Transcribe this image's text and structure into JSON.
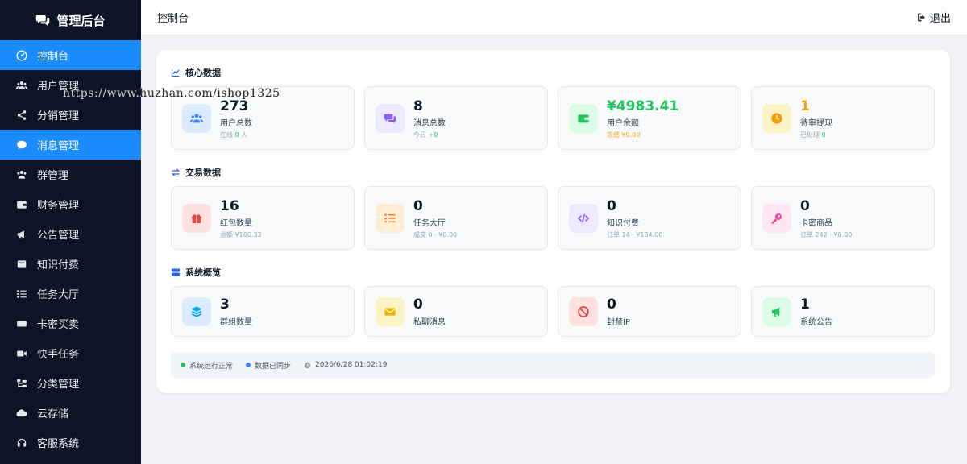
{
  "sidebar": {
    "brand": "管理后台",
    "items": [
      {
        "label": "控制台",
        "icon": "dashboard-icon",
        "active": true
      },
      {
        "label": "用户管理",
        "icon": "users-icon"
      },
      {
        "label": "分销管理",
        "icon": "share-icon"
      },
      {
        "label": "消息管理",
        "icon": "comment-icon",
        "active": true
      },
      {
        "label": "群管理",
        "icon": "group-icon"
      },
      {
        "label": "财务管理",
        "icon": "wallet-icon"
      },
      {
        "label": "公告管理",
        "icon": "megaphone-icon"
      },
      {
        "label": "知识付费",
        "icon": "book-icon"
      },
      {
        "label": "任务大厅",
        "icon": "task-list-icon"
      },
      {
        "label": "卡密买卖",
        "icon": "card-icon"
      },
      {
        "label": "快手任务",
        "icon": "video-icon"
      },
      {
        "label": "分类管理",
        "icon": "category-icon"
      },
      {
        "label": "云存储",
        "icon": "cloud-icon"
      },
      {
        "label": "客服系统",
        "icon": "headset-icon"
      }
    ]
  },
  "header": {
    "title": "控制台",
    "logout": "退出"
  },
  "sections": {
    "core": "核心数据",
    "trade": "交易数据",
    "system": "系统概览"
  },
  "core_cards": [
    {
      "value": "273",
      "label": "用户总数",
      "sub_prefix": "在线 ",
      "sub_value": "0",
      "sub_suffix": " 人"
    },
    {
      "value": "8",
      "label": "消息总数",
      "sub_prefix": "今日 ",
      "sub_value": "+0",
      "sub_suffix": ""
    },
    {
      "value": "¥4983.41",
      "label": "用户余额",
      "sub_prefix": "冻结 ",
      "sub_value": "¥0.00",
      "sub_suffix": ""
    },
    {
      "value": "1",
      "label": "待审提现",
      "sub_prefix": "已处理 ",
      "sub_value": "0",
      "sub_suffix": ""
    }
  ],
  "trade_cards": [
    {
      "value": "16",
      "label": "红包数量",
      "sub": "总额 ¥160.33"
    },
    {
      "value": "0",
      "label": "任务大厅",
      "sub": "成交 0 · ¥0.00"
    },
    {
      "value": "0",
      "label": "知识付费",
      "sub": "订单 14 · ¥134.00"
    },
    {
      "value": "0",
      "label": "卡密商品",
      "sub": "订单 242 · ¥0.00"
    }
  ],
  "system_cards": [
    {
      "value": "3",
      "label": "群组数量"
    },
    {
      "value": "0",
      "label": "私聊消息"
    },
    {
      "value": "0",
      "label": "封禁IP"
    },
    {
      "value": "1",
      "label": "系统公告"
    }
  ],
  "status": {
    "running": "系统运行正常",
    "synced": "数据已同步",
    "time": "2026/6/28 01:02:19"
  },
  "watermark": "https://www.huzhan.com/ishop1325",
  "colors": {
    "sidebar_bg": "#0c1526",
    "active": "#1a8cff",
    "green": "#22c55e",
    "orange": "#f59e0b"
  }
}
